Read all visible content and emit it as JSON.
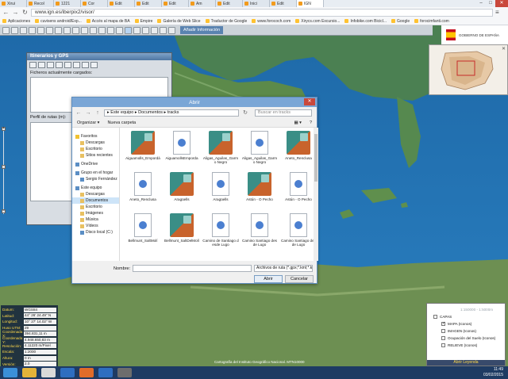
{
  "browser": {
    "tabs": [
      "Xirui",
      "Recol",
      "1221",
      "Cor",
      "Edit",
      "Edit",
      "Edit",
      "Am",
      "Edit",
      "Inici",
      "Edit",
      "IGN"
    ],
    "active_tab": 11,
    "url": "www.ign.es/iberpix2/visor/",
    "bookmarks": [
      "Aplicaciones",
      "cuvisens android/Exp...",
      "Accés al mapa de BA",
      "Empire",
      "Galería de Web Slice",
      "Traductor de Google",
      "www.forococh.com",
      "Xirycs.com Excursio...",
      "Infobike.com Bicicl...",
      "Google",
      "forocimfanti.com"
    ]
  },
  "toolbar": {
    "add_info_label": "Añadir Información"
  },
  "logo": {
    "text": "GOBIERNO DE ESPAÑA"
  },
  "itin_panel": {
    "title": "Itinerarios y GPS",
    "loaded_label": "Ficheros actualmente cargados:",
    "profile_label": "Perfil de rutas (m):"
  },
  "dialog": {
    "title": "Abrir",
    "path": [
      "Este equipo",
      "Documentos",
      "tracks"
    ],
    "path_text": "▸ Este equipo ▸ Documentos ▸ tracks",
    "search_placeholder": "Buscar en tracks",
    "organize": "Organizar ▾",
    "new_folder": "Nueva carpeta",
    "nav": [
      {
        "label": "Favoritos",
        "head": true,
        "icon": "star"
      },
      {
        "label": "Descargas",
        "icon": "folder"
      },
      {
        "label": "Escritorio",
        "icon": "folder"
      },
      {
        "label": "Sitios recientes",
        "icon": "folder"
      },
      {
        "label": "OneDrive",
        "head": true,
        "icon": "cloud"
      },
      {
        "label": "Grupo en el hogar",
        "head": true,
        "icon": "home"
      },
      {
        "label": "Sergio Fernández",
        "icon": "user"
      },
      {
        "label": "Este equipo",
        "head": true,
        "icon": "pc"
      },
      {
        "label": "Descargas",
        "icon": "folder"
      },
      {
        "label": "Documentos",
        "icon": "folder",
        "selected": true
      },
      {
        "label": "Escritorio",
        "icon": "folder"
      },
      {
        "label": "Imágenes",
        "icon": "folder"
      },
      {
        "label": "Música",
        "icon": "folder"
      },
      {
        "label": "Vídeos",
        "icon": "folder"
      },
      {
        "label": "Disco local (C:)",
        "icon": "drive"
      }
    ],
    "files": [
      {
        "name": "Aiguamolls_Empordà",
        "kind": "app"
      },
      {
        "name": "AiguamollsEmporda",
        "kind": "doc"
      },
      {
        "name": "Aligas_Aguilas_Garmo Negro",
        "kind": "app"
      },
      {
        "name": "Aligas_Aguilas_Garmo Negro",
        "kind": "doc"
      },
      {
        "name": "Aneto_Renclusa",
        "kind": "app"
      },
      {
        "name": "Aneto_Renclusa",
        "kind": "doc"
      },
      {
        "name": "Aragüells",
        "kind": "app"
      },
      {
        "name": "Aragüells",
        "kind": "doc"
      },
      {
        "name": "Astún - O Pecho",
        "kind": "app"
      },
      {
        "name": "Astún - O Pecho",
        "kind": "doc"
      },
      {
        "name": "Bellmunt_SaltMolí",
        "kind": "doc"
      },
      {
        "name": "Bellmunt_SaltDelMolí",
        "kind": "app"
      },
      {
        "name": "Camino de Santiago desde Lugo",
        "kind": "doc"
      },
      {
        "name": "Camino Santiago desde Lugo",
        "kind": "doc"
      },
      {
        "name": "Camino Santiago desde Lugo",
        "kind": "doc"
      }
    ],
    "name_label": "Nombre:",
    "name_value": "",
    "filter": "Archivos de ruta (*.gpx;*.kml;*.k",
    "open_label": "Abrir",
    "cancel_label": "Cancelar"
  },
  "coords": [
    {
      "label": "Datum:",
      "value": "WGS84"
    },
    {
      "label": "Latitud:",
      "value": "44° 26' 24.49\" N"
    },
    {
      "label": "Longitud:",
      "value": "10° 27' 14.02\" W"
    },
    {
      "label": "Huso UTM:",
      "value": "29"
    },
    {
      "label": "Coordenada X:",
      "value": "394.831,11 m"
    },
    {
      "label": "Coordenada Y:",
      "value": "4.948.650,83 m"
    },
    {
      "label": "Resolución:",
      "value": "4.11220 m/Pixel"
    },
    {
      "label": "Escala:",
      "value": "1:2000"
    },
    {
      "label": "Altura:",
      "value": "0 m"
    },
    {
      "label": "Versión:",
      "value": "2.0"
    }
  ],
  "credit": "Cartografía del Instituto Geográfico Nacional. MTN10000",
  "layers": {
    "title": "CAPAS",
    "scale_hint": "1:150000 - 1:5000m",
    "items": [
      {
        "label": "CAPAS",
        "checked": false
      },
      {
        "label": "MAPA (Iconos)",
        "checked": true
      },
      {
        "label": "IMAGEN (Iconos)",
        "checked": false
      },
      {
        "label": "Ocupación del Suelo (Iconos)",
        "checked": false
      },
      {
        "label": "RELIEVE (Iconos)",
        "checked": false
      }
    ],
    "footer": "Abrir Leyenda"
  },
  "tray": {
    "time": "11:49",
    "date": "03/02/2015"
  },
  "colors": {
    "sea": "#1f6fb0",
    "land": "#3f7a45",
    "dialog_title": "#7aa6d6",
    "close": "#c9483c"
  }
}
